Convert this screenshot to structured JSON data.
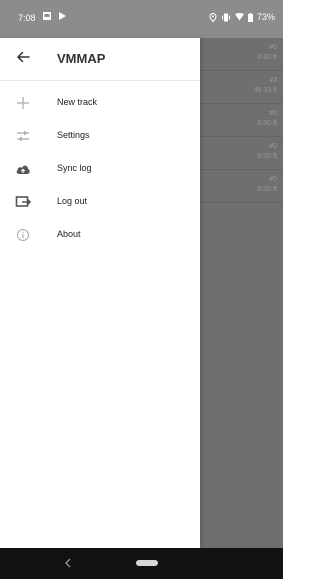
{
  "status_bar": {
    "time": "7:08",
    "battery": "73%"
  },
  "app": {
    "title": "VMMAP"
  },
  "menu": [
    {
      "label": "New track",
      "icon": "plus-icon"
    },
    {
      "label": "Settings",
      "icon": "sliders-icon"
    },
    {
      "label": "Sync log",
      "icon": "cloud-upload-icon"
    },
    {
      "label": "Log out",
      "icon": "logout-icon"
    },
    {
      "label": "About",
      "icon": "info-icon"
    }
  ],
  "tracks": [
    {
      "id": "#0",
      "distance": "0.00 ft"
    },
    {
      "id": "#3",
      "distance": "46.33 ft"
    },
    {
      "id": "#0",
      "distance": "0.00 ft"
    },
    {
      "id": "#0",
      "distance": "0.00 ft"
    },
    {
      "id": "#0",
      "distance": "0.00 ft"
    }
  ]
}
